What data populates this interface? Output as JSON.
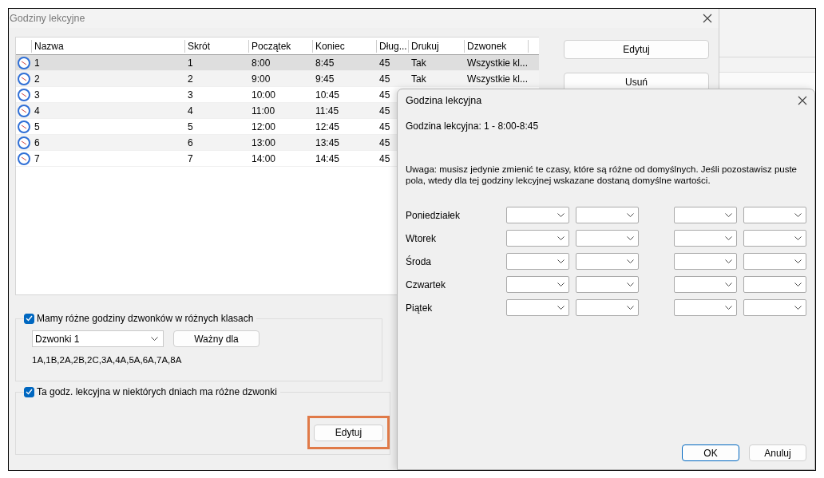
{
  "main_window": {
    "title": "Godziny lekcyjne",
    "table": {
      "columns": [
        "Nazwa",
        "Skrót",
        "Początek",
        "Koniec",
        "Dług...",
        "Drukuj",
        "Dzwonek"
      ],
      "rows": [
        {
          "selected": true,
          "cells": [
            "1",
            "1",
            "8:00",
            "8:45",
            "45",
            "Tak",
            "Wszystkie kl..."
          ]
        },
        {
          "selected": false,
          "cells": [
            "2",
            "2",
            "9:00",
            "9:45",
            "45",
            "Tak",
            "Wszystkie kl..."
          ]
        },
        {
          "selected": false,
          "cells": [
            "3",
            "3",
            "10:00",
            "10:45",
            "45"
          ]
        },
        {
          "selected": false,
          "cells": [
            "4",
            "4",
            "11:00",
            "11:45",
            "45"
          ]
        },
        {
          "selected": false,
          "cells": [
            "5",
            "5",
            "12:00",
            "12:45",
            "45"
          ]
        },
        {
          "selected": false,
          "cells": [
            "6",
            "6",
            "13:00",
            "13:45",
            "45"
          ]
        },
        {
          "selected": false,
          "cells": [
            "7",
            "7",
            "14:00",
            "14:45",
            "45"
          ]
        }
      ]
    },
    "buttons": [
      "Edytuj",
      "Usuń"
    ],
    "class_bells": {
      "label": "Mamy różne godziny dzwonków w różnych klasach",
      "checked": true,
      "combo_value": "Dzwonki 1",
      "button": "Ważny dla",
      "classes": "1A,1B,2A,2B,2C,3A,4A,5A,6A,7A,8A"
    },
    "day_bells": {
      "label": "Ta godz. lekcyjna w niektórych dniach ma różne dzwonki",
      "checked": true,
      "button": "Edytuj",
      "highlighted": true
    }
  },
  "dialog": {
    "title": "Godzina lekcyjna",
    "summary": "Godzina lekcyjna: 1 - 8:00-8:45",
    "note": "Uwaga: musisz jedynie zmienić te czasy, które są różne od domyślnych. Jeśli pozostawisz puste pola, wtedy dla tej godziny lekcyjnej wskazane dostaną domyślne wartości.",
    "days": [
      "Poniedziałek",
      "Wtorek",
      "Środa",
      "Czwartek",
      "Piątek"
    ],
    "buttons": [
      {
        "label": "OK",
        "default": true
      },
      {
        "label": "Anuluj",
        "default": false
      }
    ]
  }
}
